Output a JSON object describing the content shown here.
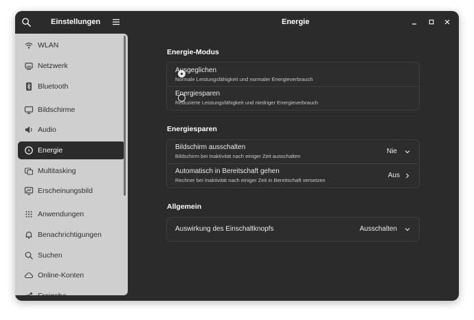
{
  "window": {
    "sidebar_title": "Einstellungen",
    "page_title": "Energie"
  },
  "sidebar": {
    "items": [
      {
        "label": "WLAN",
        "icon": "wifi-icon"
      },
      {
        "label": "Netzwerk",
        "icon": "network-icon"
      },
      {
        "label": "Bluetooth",
        "icon": "bluetooth-icon"
      },
      {
        "label": "Bildschirme",
        "icon": "display-icon"
      },
      {
        "label": "Audio",
        "icon": "speaker-icon"
      },
      {
        "label": "Energie",
        "icon": "power-icon",
        "active": true
      },
      {
        "label": "Multitasking",
        "icon": "multitasking-icon"
      },
      {
        "label": "Erscheinungsbild",
        "icon": "appearance-icon"
      },
      {
        "label": "Anwendungen",
        "icon": "apps-grid-icon"
      },
      {
        "label": "Benachrichtigungen",
        "icon": "bell-icon"
      },
      {
        "label": "Suchen",
        "icon": "search-icon"
      },
      {
        "label": "Online-Konten",
        "icon": "cloud-icon"
      },
      {
        "label": "Freigabe",
        "icon": "share-icon"
      }
    ]
  },
  "power_mode": {
    "heading": "Energie-Modus",
    "options": [
      {
        "title": "Ausgeglichen",
        "subtitle": "Normale Leistungsfähigkeit und normaler Energieverbrauch",
        "selected": true
      },
      {
        "title": "Energiesparen",
        "subtitle": "Reduzierte Leistungsfähigkeit und niedriger Energieverbrauch",
        "selected": false
      }
    ]
  },
  "power_saving": {
    "heading": "Energiesparen",
    "rows": [
      {
        "title": "Bildschirm ausschalten",
        "subtitle": "Bildschirm bei Inaktivität nach einiger Zeit ausschalten",
        "value": "Nie",
        "control": "dropdown"
      },
      {
        "title": "Automatisch in Bereitschaft gehen",
        "subtitle": "Rechner bei Inaktivität nach einiger Zeit in Bereitschaft versetzen",
        "value": "Aus",
        "control": "arrow"
      }
    ]
  },
  "general": {
    "heading": "Allgemein",
    "rows": [
      {
        "title": "Auswirkung des Einschaltknopfs",
        "value": "Ausschalten",
        "control": "dropdown"
      }
    ]
  },
  "colors": {
    "window_bg": "#2b2b2b",
    "sidebar_bg": "#cfcfcf",
    "active_item_bg": "#2b2b2b",
    "text_light": "#ffffff"
  }
}
